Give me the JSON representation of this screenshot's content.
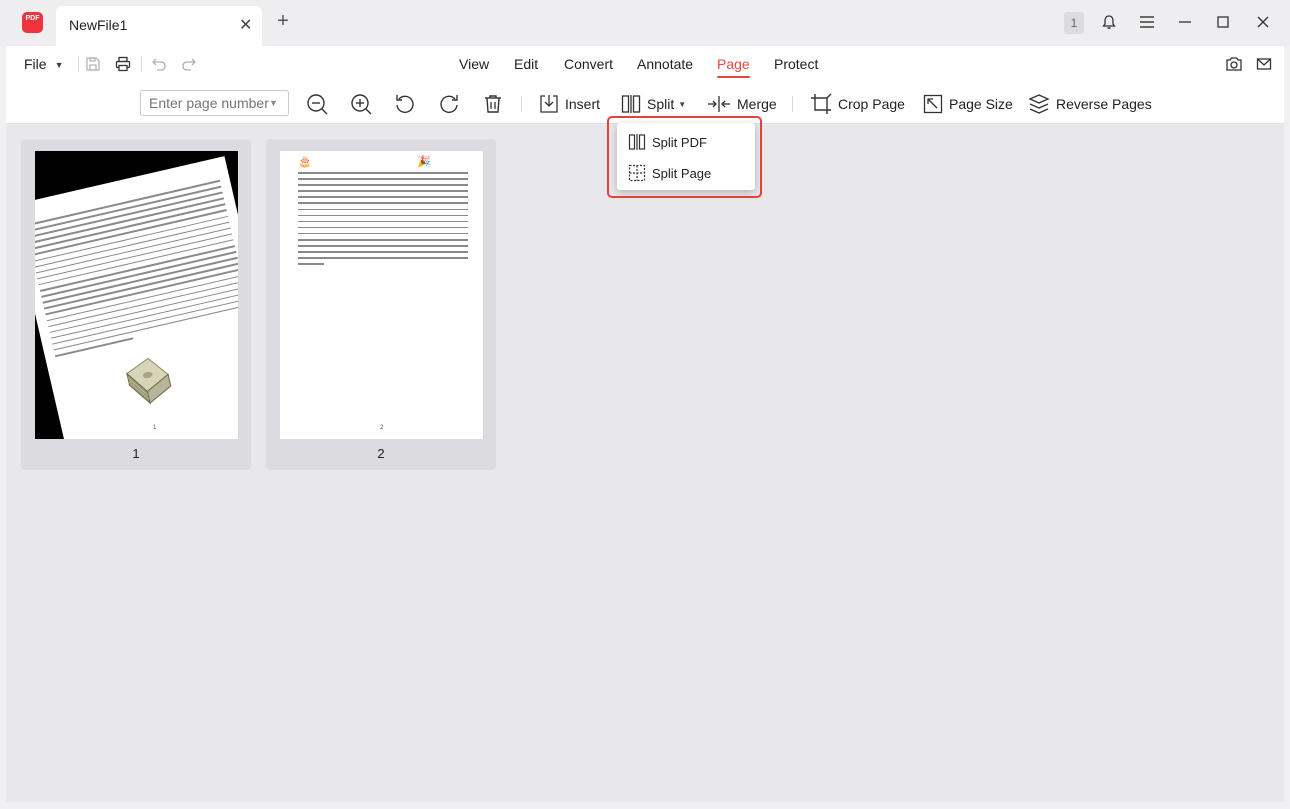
{
  "app": {
    "logo_text": "PDF",
    "tab_title": "NewFile1",
    "notification_count": "1"
  },
  "menu": {
    "file_label": "File",
    "tabs": [
      {
        "label": "View"
      },
      {
        "label": "Edit"
      },
      {
        "label": "Convert"
      },
      {
        "label": "Annotate"
      },
      {
        "label": "Page",
        "active": true
      },
      {
        "label": "Protect"
      }
    ]
  },
  "toolbar": {
    "page_number_placeholder": "Enter page number",
    "insert_label": "Insert",
    "split_label": "Split",
    "merge_label": "Merge",
    "crop_label": "Crop Page",
    "page_size_label": "Page Size",
    "reverse_label": "Reverse Pages"
  },
  "split_menu": {
    "items": [
      {
        "label": "Split PDF",
        "icon": "split-pdf-icon"
      },
      {
        "label": "Split Page",
        "icon": "split-page-icon"
      }
    ]
  },
  "pages": [
    {
      "label": "1",
      "footer": "1"
    },
    {
      "label": "2",
      "footer": "2"
    }
  ],
  "colors": {
    "accent": "#e8453c",
    "highlight": "#e5413a",
    "logo": "#f0323c"
  }
}
